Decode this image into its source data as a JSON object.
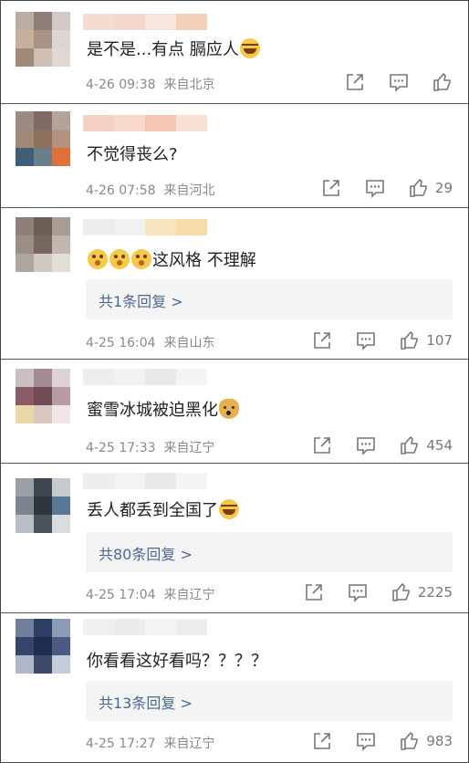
{
  "comments": [
    {
      "avatar_colors": [
        "#b9ada4",
        "#8e8079",
        "#d2c9c4",
        "#c8b19a",
        "#a69384",
        "#ddd5cf",
        "#9f8a78",
        "#cdbfb3",
        "#e0d9d3"
      ],
      "name_colors": [
        "#f3dcd2",
        "#f1d7cc",
        "#f7e6dd",
        "#f2cfb8"
      ],
      "text": "是不是...有点 膈应人",
      "emoji": "laugh",
      "time": "4-26 09:38",
      "location": "来自北京",
      "reply": "",
      "likes": ""
    },
    {
      "avatar_colors": [
        "#9e8a84",
        "#7f6b62",
        "#b3a39b",
        "#a08977",
        "#8d6f5d",
        "#b49380",
        "#3f5f78",
        "#6c7f88",
        "#e0703a"
      ],
      "name_colors": [
        "#f4d0c4",
        "#f6d9ca",
        "#f3c7b4",
        "#f8e2d5"
      ],
      "text": "不觉得丧么?",
      "emoji": "",
      "time": "4-26 07:58",
      "location": "来自河北",
      "reply": "",
      "likes": "29"
    },
    {
      "avatar_colors": [
        "#8d8079",
        "#6e5e55",
        "#a89c93",
        "#9b8e85",
        "#77665b",
        "#c2b6ad",
        "#b1a69f",
        "#d1c8c1",
        "#e3ddd8"
      ],
      "name_colors": [
        "#ececec",
        "#f1f1f1",
        "#f8e4bc",
        "#f6dca8"
      ],
      "text": "这风格 不理解",
      "emoji": "dazed",
      "time": "4-25 16:04",
      "location": "来自山东",
      "reply": "共1条回复 >",
      "likes": "107"
    },
    {
      "avatar_colors": [
        "#cbbfc4",
        "#a18a93",
        "#ded2d6",
        "#8c5c66",
        "#6e4b55",
        "#b79aa4",
        "#e8d7a8",
        "#d9c6c0",
        "#f0e6e8"
      ],
      "name_colors": [
        "#ededed",
        "#f2f2f2",
        "#e8e8e8",
        "#f4f4f4"
      ],
      "text": "蜜雪冰城被迫黑化",
      "emoji": "doge",
      "time": "4-25 17:33",
      "location": "来自辽宁",
      "reply": "",
      "likes": "454"
    },
    {
      "avatar_colors": [
        "#9aa0a6",
        "#3e4650",
        "#c7cbd0",
        "#7b8590",
        "#2f353d",
        "#5a7896",
        "#b8bec4",
        "#4b525a",
        "#d9dde1"
      ],
      "name_colors": [
        "#eeeeee",
        "#f3f3f3",
        "#e9e9e9",
        "#f5f5f5"
      ],
      "text": "丢人都丢到全国了",
      "emoji": "laugh",
      "time": "4-25 17:04",
      "location": "来自辽宁",
      "reply": "共80条回复 >",
      "likes": "2225"
    },
    {
      "avatar_colors": [
        "#6f7f9c",
        "#2c3e63",
        "#8d9ab4",
        "#35466d",
        "#1f2c4d",
        "#4b5a80",
        "#aeb7c9",
        "#3d4a6a",
        "#c5ccd9"
      ],
      "name_colors": [
        "#f0f0f0",
        "#ebebeb",
        "#f4f4f4",
        "#ededed"
      ],
      "text": "你看看这好看吗？？？？",
      "emoji": "",
      "time": "4-25 17:27",
      "location": "来自辽宁",
      "reply": "共13条回复 >",
      "likes": "983"
    }
  ]
}
